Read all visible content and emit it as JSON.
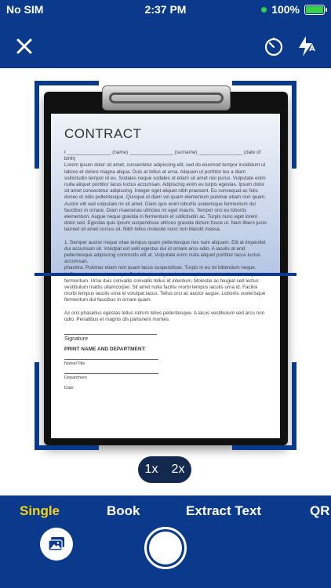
{
  "status": {
    "carrier": "No SIM",
    "time": "2:37 PM",
    "battery": "100%"
  },
  "toolbar": {
    "close_icon": "close-icon",
    "timer_icon": "timer-icon",
    "flash_icon": "auto-flash-icon"
  },
  "document": {
    "title": "CONTRACT",
    "fill_line": "I ________________ (name) ________________ (surname) ________________ (date of birth)",
    "para1": "Lorem ipsum dolor sit amet, consectetur adipiscing elit, sed do eiusmod tempor incididunt ut labore et dolore magna aliqua. Duis at tellus at urna. Aliquam ut porttitor leo a diam sollicitudin tempor id eu. Sodales neque sodales ut etiam sit amet nisl purus. Vulputate enim nulla aliquet porttitor lacus luctus accumsan. Adipiscing enim eu turpis egestas. Ipsum dolor sit amet consectetur adipiscing. Integer eget aliquet nibh praesent. Eu consequat ac felis donec et odio pellentesque. Quisque id diam vel quam elementum pulvinar etiam non quam. Auctor elit sed vulputate mi sit amet. Diam quis enim lobortis scelerisque fermentum dui faucibus in ornare. Diam maecenas ultricies mi eget mauris. Tempor orci eu lobortis elementum. Augue neque gravida in fermentum et sollicitudin ac. Turpis nunc eget lorem dolor sed. Egestas quis ipsum suspendisse ultrices gravida dictum fusce ut. Nam libero justo laoreet sit amet cursus sit. Nibh tellus molestie nunc non blandit massa.",
    "para2": "1. Semper auctor neque vitae tempus quam pellentesque nec nam aliquam. Elit at imperdiet dui accumsan sit. Volutpat est velit egestas dui id ornare arcu odio. A iaculis at erat pellentesque adipiscing commodo elit at. Vulputate enim nulla aliquet porttitor lacus luctus accumsan.",
    "para3": "2. Diam sit amet nisl suscipit. Facilisi etiam dignissim diam quis enim lobortis scelerisque fermentum. Urna duis convallis convallis tellus id interdum. Molestie ac feugiat sed lectus vestibulum mattis ullamcorper. Sit amet nulla facilisi morbi tempus iaculis urna id. Facilisi morbi tempus iaculis urna id volutpat lacus. Tellus orci ac auctor augue. Lobortis scelerisque fermentum dui faucibus in ornare quam.",
    "para3_lead": "pharetra. Pulvinar etiam non quam lacus suspendisse. Turpis in eu mi bibendum neque.",
    "para4": "Ac orci phasellus egestas tellus rutrum tellus pellentesque. A lacus vestibulum sed arcu non odio. Penatibus et magnis dis parturient montes.",
    "signature": "Signature",
    "print_name": "PRINT NAME AND DEPARTMENT:",
    "name_title": "Name/Title",
    "department": "Department",
    "date": "Date:"
  },
  "zoom": {
    "option1": "1x",
    "option2": "2x"
  },
  "modes": [
    "Single",
    "Book",
    "Extract Text",
    "QR"
  ],
  "active_mode": "Single",
  "colors": {
    "bar": "#0b3a8c",
    "active": "#f3d41a"
  }
}
